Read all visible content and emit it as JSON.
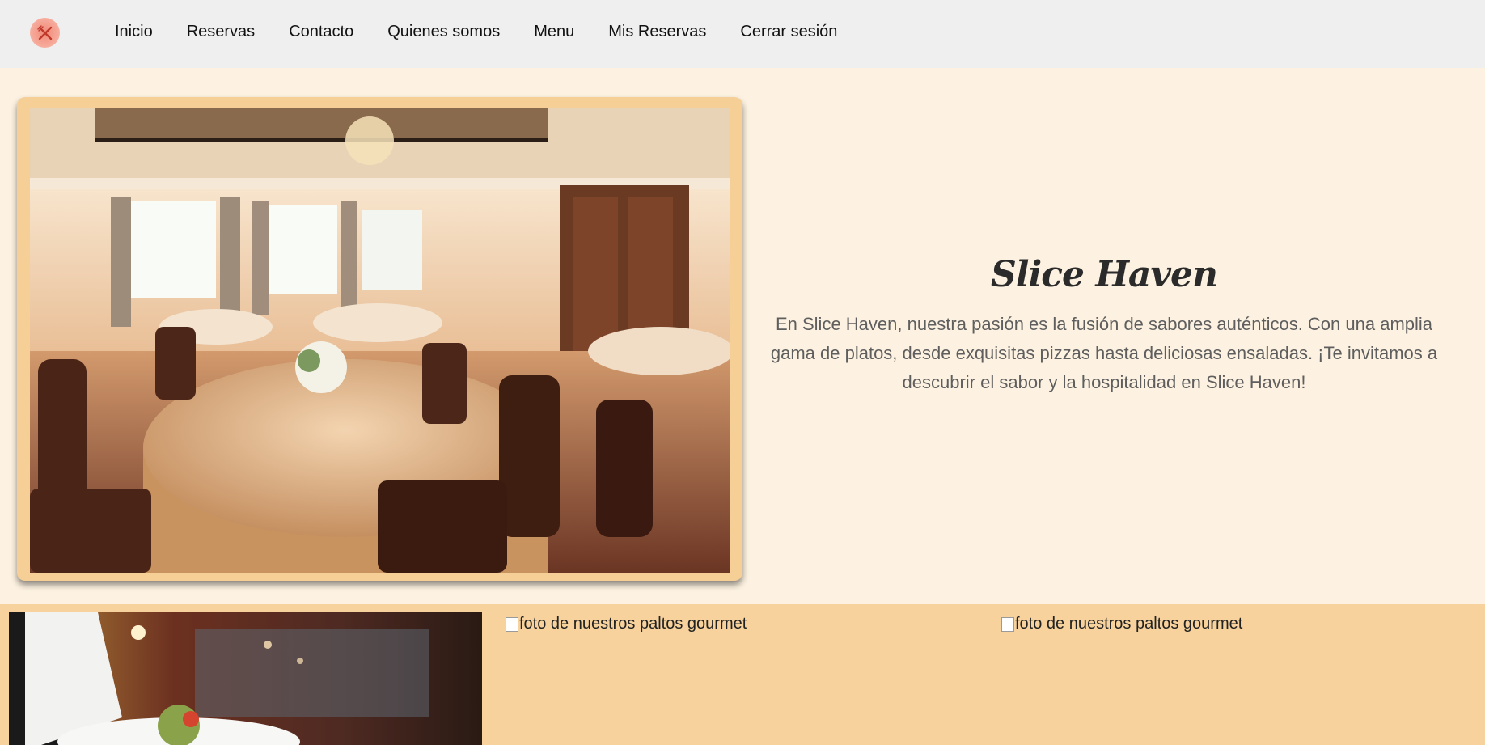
{
  "navbar": {
    "logo_icon": "fork-knife-icon",
    "links": [
      {
        "label": "Inicio"
      },
      {
        "label": "Reservas"
      },
      {
        "label": "Contacto"
      },
      {
        "label": "Quienes somos"
      },
      {
        "label": "Menu"
      },
      {
        "label": "Mis Reservas"
      },
      {
        "label": "Cerrar sesión"
      }
    ]
  },
  "hero": {
    "title": "Slice Haven",
    "description": "En Slice Haven, nuestra pasión es la fusión de sabores auténticos. Con una amplia gama de platos, desde exquisitas pizzas hasta deliciosas ensaladas. ¡Te invitamos a descubrir el sabor y la hospitalidad en Slice Haven!"
  },
  "gallery": {
    "items": [
      {
        "alt": "foto de nuestros paltos gourmet"
      },
      {
        "alt": "foto de nuestros paltos gourmet"
      }
    ]
  },
  "colors": {
    "navbar_bg": "#efefef",
    "hero_bg": "#fdf2e1",
    "accent_frame": "#f6cf97",
    "gallery_bg": "#f7d29c",
    "logo_accent": "#f08a7a"
  }
}
